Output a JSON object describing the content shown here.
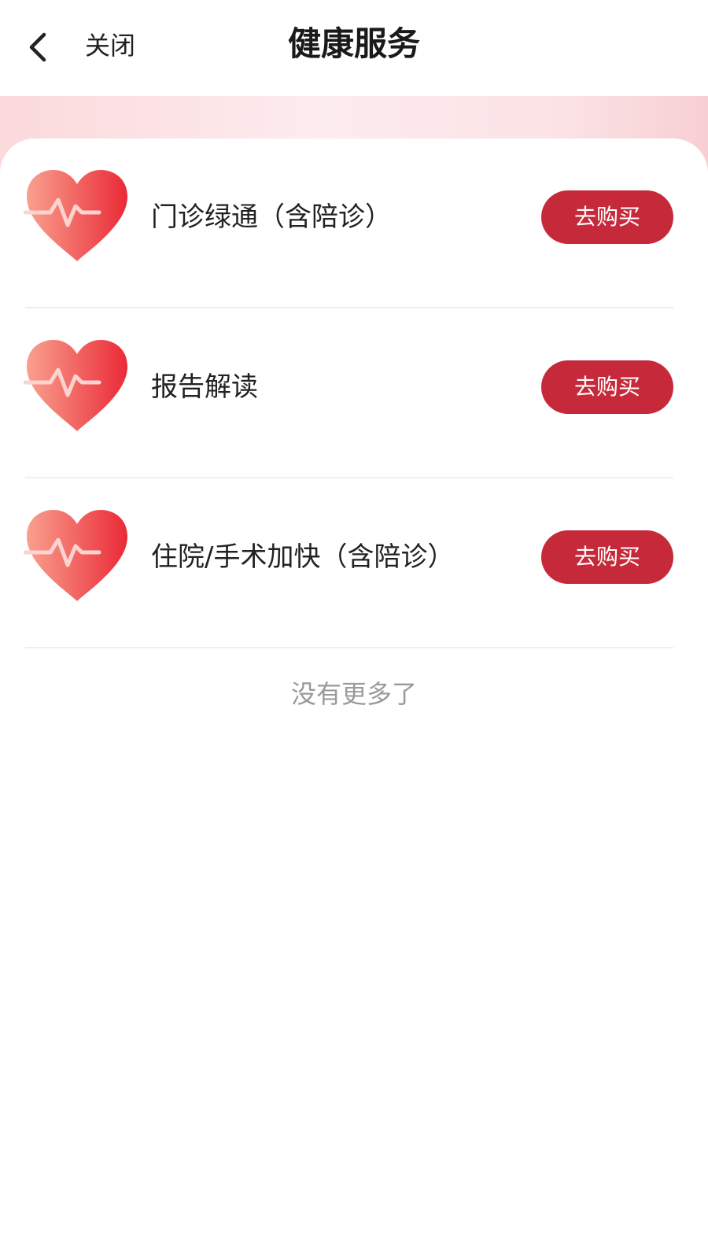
{
  "header": {
    "back_icon": "chevron-left-icon",
    "close_label": "关闭",
    "title": "健康服务"
  },
  "colors": {
    "accent": "#c62a3a",
    "heart_light": "#f9a08e",
    "heart_dark": "#ea2a37",
    "banner": "#fbd9dc"
  },
  "services": [
    {
      "name": "门诊绿通（含陪诊）",
      "icon": "heart-pulse-icon",
      "button_label": "去购买"
    },
    {
      "name": "报告解读",
      "icon": "heart-pulse-icon",
      "button_label": "去购买"
    },
    {
      "name": "住院/手术加快（含陪诊）",
      "icon": "heart-pulse-icon",
      "button_label": "去购买"
    }
  ],
  "footer": {
    "end_text": "没有更多了"
  }
}
